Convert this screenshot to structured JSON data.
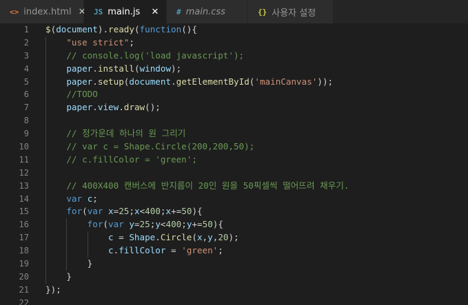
{
  "tabs": [
    {
      "icon": "<>",
      "icon_name": "html-file-icon",
      "icon_color": "#e37933",
      "label": "index.html",
      "italic": false,
      "active": false,
      "close": "✕"
    },
    {
      "icon": "JS",
      "icon_name": "js-file-icon",
      "icon_color": "#519aba",
      "label": "main.js",
      "italic": false,
      "active": true,
      "close": "✕"
    },
    {
      "icon": "#",
      "icon_name": "css-file-icon",
      "icon_color": "#519aba",
      "label": "main.css",
      "italic": true,
      "active": false,
      "close": ""
    },
    {
      "icon": "{}",
      "icon_name": "json-file-icon",
      "icon_color": "#cbcb41",
      "label": "사용자 설정",
      "italic": false,
      "active": false,
      "close": ""
    }
  ],
  "editor": {
    "lines": [
      {
        "n": "1",
        "tokens": [
          [
            "$",
            "fn"
          ],
          [
            "(",
            "def"
          ],
          [
            "document",
            "var"
          ],
          [
            ").",
            "def"
          ],
          [
            "ready",
            "fn"
          ],
          [
            "(",
            "def"
          ],
          [
            "function",
            "kw"
          ],
          [
            "(){",
            "def"
          ]
        ]
      },
      {
        "n": "2",
        "tokens": [
          [
            "    ",
            "def"
          ],
          [
            "\"use strict\"",
            "str"
          ],
          [
            ";",
            "def"
          ]
        ]
      },
      {
        "n": "3",
        "tokens": [
          [
            "    ",
            "def"
          ],
          [
            "// console.log('load javascript');",
            "com"
          ]
        ]
      },
      {
        "n": "4",
        "tokens": [
          [
            "    ",
            "def"
          ],
          [
            "paper",
            "var"
          ],
          [
            ".",
            "def"
          ],
          [
            "install",
            "fn"
          ],
          [
            "(",
            "def"
          ],
          [
            "window",
            "var"
          ],
          [
            ");",
            "def"
          ]
        ]
      },
      {
        "n": "5",
        "tokens": [
          [
            "    ",
            "def"
          ],
          [
            "paper",
            "var"
          ],
          [
            ".",
            "def"
          ],
          [
            "setup",
            "fn"
          ],
          [
            "(",
            "def"
          ],
          [
            "document",
            "var"
          ],
          [
            ".",
            "def"
          ],
          [
            "getElementById",
            "fn"
          ],
          [
            "(",
            "def"
          ],
          [
            "'mainCanvas'",
            "str"
          ],
          [
            "));",
            "def"
          ]
        ]
      },
      {
        "n": "6",
        "tokens": [
          [
            "    ",
            "def"
          ],
          [
            "//TODO",
            "com"
          ]
        ]
      },
      {
        "n": "7",
        "tokens": [
          [
            "    ",
            "def"
          ],
          [
            "paper",
            "var"
          ],
          [
            ".",
            "def"
          ],
          [
            "view",
            "var"
          ],
          [
            ".",
            "def"
          ],
          [
            "draw",
            "fn"
          ],
          [
            "();",
            "def"
          ]
        ]
      },
      {
        "n": "8",
        "tokens": []
      },
      {
        "n": "9",
        "tokens": [
          [
            "    ",
            "def"
          ],
          [
            "// 정가운데 하나의 원 그리기",
            "com"
          ]
        ]
      },
      {
        "n": "10",
        "tokens": [
          [
            "    ",
            "def"
          ],
          [
            "// var c = Shape.Circle(200,200,50);",
            "com"
          ]
        ]
      },
      {
        "n": "11",
        "tokens": [
          [
            "    ",
            "def"
          ],
          [
            "// c.fillColor = 'green';",
            "com"
          ]
        ]
      },
      {
        "n": "12",
        "tokens": []
      },
      {
        "n": "13",
        "tokens": [
          [
            "    ",
            "def"
          ],
          [
            "// 400X400 캔버스에 반지름이 20인 원을 50픽셀씩 떨어뜨려 채우기.",
            "com"
          ]
        ]
      },
      {
        "n": "14",
        "tokens": [
          [
            "    ",
            "def"
          ],
          [
            "var",
            "kw"
          ],
          [
            " ",
            "def"
          ],
          [
            "c",
            "var"
          ],
          [
            ";",
            "def"
          ]
        ]
      },
      {
        "n": "15",
        "tokens": [
          [
            "    ",
            "def"
          ],
          [
            "for",
            "kw"
          ],
          [
            "(",
            "def"
          ],
          [
            "var",
            "kw"
          ],
          [
            " ",
            "def"
          ],
          [
            "x",
            "var"
          ],
          [
            "=",
            "def"
          ],
          [
            "25",
            "num"
          ],
          [
            ";",
            "def"
          ],
          [
            "x",
            "var"
          ],
          [
            "<",
            "def"
          ],
          [
            "400",
            "num"
          ],
          [
            ";",
            "def"
          ],
          [
            "x",
            "var"
          ],
          [
            "+=",
            "def"
          ],
          [
            "50",
            "num"
          ],
          [
            "){",
            "def"
          ]
        ]
      },
      {
        "n": "16",
        "tokens": [
          [
            "        ",
            "def"
          ],
          [
            "for",
            "kw"
          ],
          [
            "(",
            "def"
          ],
          [
            "var",
            "kw"
          ],
          [
            " ",
            "def"
          ],
          [
            "y",
            "var"
          ],
          [
            "=",
            "def"
          ],
          [
            "25",
            "num"
          ],
          [
            ";",
            "def"
          ],
          [
            "y",
            "var"
          ],
          [
            "<",
            "def"
          ],
          [
            "400",
            "num"
          ],
          [
            ";",
            "def"
          ],
          [
            "y",
            "var"
          ],
          [
            "+=",
            "def"
          ],
          [
            "50",
            "num"
          ],
          [
            "){",
            "def"
          ]
        ]
      },
      {
        "n": "17",
        "tokens": [
          [
            "            ",
            "def"
          ],
          [
            "c",
            "var"
          ],
          [
            " = ",
            "def"
          ],
          [
            "Shape",
            "var"
          ],
          [
            ".",
            "def"
          ],
          [
            "Circle",
            "fn"
          ],
          [
            "(",
            "def"
          ],
          [
            "x",
            "var"
          ],
          [
            ",",
            "def"
          ],
          [
            "y",
            "var"
          ],
          [
            ",",
            "def"
          ],
          [
            "20",
            "num"
          ],
          [
            ");",
            "def"
          ]
        ]
      },
      {
        "n": "18",
        "tokens": [
          [
            "            ",
            "def"
          ],
          [
            "c",
            "var"
          ],
          [
            ".",
            "def"
          ],
          [
            "fillColor",
            "var"
          ],
          [
            " = ",
            "def"
          ],
          [
            "'green'",
            "str"
          ],
          [
            ";",
            "def"
          ]
        ]
      },
      {
        "n": "19",
        "tokens": [
          [
            "        ",
            "def"
          ],
          [
            "}",
            "def"
          ]
        ]
      },
      {
        "n": "20",
        "tokens": [
          [
            "    ",
            "def"
          ],
          [
            "}",
            "def"
          ]
        ]
      },
      {
        "n": "21",
        "tokens": [
          [
            "});",
            "def"
          ]
        ]
      },
      {
        "n": "22",
        "tokens": []
      }
    ]
  }
}
